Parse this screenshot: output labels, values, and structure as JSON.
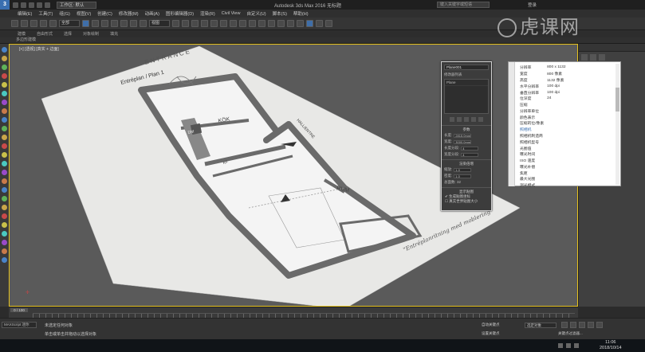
{
  "app": {
    "title": "Autodesk 3ds Max 2016    无标题",
    "workspace": "工作区: 默认",
    "search_placeholder": "键入关键字或短语",
    "user": "登录"
  },
  "menu": [
    "编辑(E)",
    "工具(T)",
    "组(G)",
    "视图(V)",
    "创建(C)",
    "修改器(M)",
    "动画(A)",
    "图形编辑器(D)",
    "渲染(R)",
    "Civil View",
    "自定义(U)",
    "脚本(S)",
    "帮助(H)"
  ],
  "toolbar": {
    "selection_filter": "全部",
    "view_dropdown": "视图"
  },
  "ribbon": {
    "tabs": [
      "建模",
      "自由形式",
      "选择",
      "对象绘制",
      "填充"
    ],
    "subtitle": "多边形建模"
  },
  "viewport": {
    "label": "[+] [透视] [真实 + 边面]",
    "plan": {
      "entrance": "ENTRANCE",
      "title": "Entréplan / Plan 1",
      "rooms": [
        "KÖK",
        "RUM",
        "DM",
        "KF",
        "HALL/ENTRÉ"
      ],
      "note": "\"Entréplanritning med moblering\""
    }
  },
  "material_dialog": {
    "name": "Plane001",
    "list_label": "修改器列表",
    "list_items": [
      "Plane"
    ],
    "sections": [
      "参数",
      "渲染倍增",
      "显示贴图"
    ],
    "rows": [
      {
        "label": "长度:",
        "value": "2815.0mm"
      },
      {
        "label": "宽度:",
        "value": "3000.0mm"
      },
      {
        "label": "长度分段:",
        "value": "4"
      },
      {
        "label": "宽度分段:",
        "value": "4"
      },
      {
        "label": "缩放:",
        "value": "1.0"
      },
      {
        "label": "密度:",
        "value": "1.0"
      }
    ],
    "total_faces": "总面数: 32",
    "checkboxes": [
      "生成贴图坐标",
      "真实世界贴图大小"
    ]
  },
  "image_properties": {
    "rows": [
      {
        "k": "分辨率",
        "v": "800 x 1132"
      },
      {
        "k": "宽度",
        "v": "800 像素"
      },
      {
        "k": "高度",
        "v": "1132 像素"
      },
      {
        "k": "水平分辨率",
        "v": "100 dpi"
      },
      {
        "k": "垂直分辨率",
        "v": "100 dpi"
      },
      {
        "k": "位深度",
        "v": "24"
      },
      {
        "k": "压缩",
        "v": ""
      },
      {
        "k": "分辨率单位",
        "v": ""
      },
      {
        "k": "颜色表示",
        "v": ""
      },
      {
        "k": "压缩的位/像素",
        "v": ""
      },
      {
        "k": "照相机",
        "v": "",
        "highlight": true
      },
      {
        "k": "照相机制造商",
        "v": ""
      },
      {
        "k": "照相机型号",
        "v": ""
      },
      {
        "k": "光圈值",
        "v": ""
      },
      {
        "k": "曝光时间",
        "v": ""
      },
      {
        "k": "ISO 速度",
        "v": ""
      },
      {
        "k": "曝光补偿",
        "v": ""
      },
      {
        "k": "焦距",
        "v": ""
      },
      {
        "k": "最大光圈",
        "v": ""
      },
      {
        "k": "测光模式",
        "v": ""
      }
    ]
  },
  "timeline": {
    "frame": "0 / 100"
  },
  "status": {
    "maxscript": "MAXScript 迷你",
    "line1": "未选定任何对象",
    "line2": "单击或单击并拖动以选择对象",
    "autokey": "自动关键点",
    "selection_set": "选定对象",
    "setkey": "设置关键点",
    "filters": "关键点过滤器..."
  },
  "taskbar": {
    "time": "11:06",
    "date": "2018/10/14"
  },
  "watermark": "虎课网"
}
